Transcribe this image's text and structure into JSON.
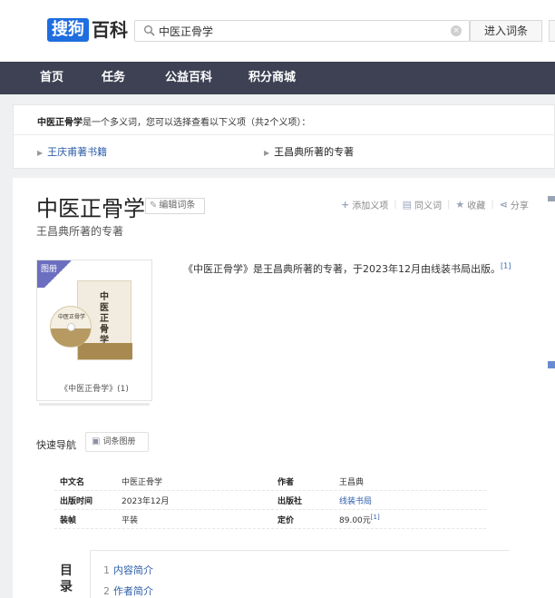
{
  "header": {
    "logo_badge": "搜狗",
    "logo_text": "百科",
    "search_value": "中医正骨学",
    "search_placeholder": "",
    "enter_button": "进入词条"
  },
  "nav": {
    "items": [
      "首页",
      "任务",
      "公益百科",
      "积分商城"
    ]
  },
  "disambiguation": {
    "term": "中医正骨学",
    "text": "是一个多义词，您可以选择查看以下义项（共2个义项）：",
    "options": [
      "王庆甫著书籍",
      "王昌典所著的专著"
    ]
  },
  "entry": {
    "title": "中医正骨学",
    "edit_label": "编辑词条",
    "subtitle": "王昌典所著的专著",
    "actions": [
      {
        "icon": "plus-icon",
        "glyph": "+",
        "label": "添加义项"
      },
      {
        "icon": "book-icon",
        "glyph": "▤",
        "label": "同义词"
      },
      {
        "icon": "star-icon",
        "glyph": "★",
        "label": "收藏"
      },
      {
        "icon": "share-icon",
        "glyph": "⋖",
        "label": "分享"
      }
    ],
    "album_tag": "图册",
    "album_caption": "《中医正骨学》(1)",
    "book_cover_title": "中医正骨学",
    "summary_text": "《中医正骨学》是王昌典所著的专著，于2023年12月由线装书局出版。",
    "summary_ref": "[1]"
  },
  "quick_nav": {
    "label": "快速导航",
    "button": "词条图册"
  },
  "info": {
    "rows": [
      {
        "k1": "中文名",
        "v1": "中医正骨学",
        "k2": "作者",
        "v2": "王昌典",
        "v2_link": false,
        "v2_ref": ""
      },
      {
        "k1": "出版时间",
        "v1": "2023年12月",
        "k2": "出版社",
        "v2": "线装书局",
        "v2_link": true,
        "v2_ref": ""
      },
      {
        "k1": "装帧",
        "v1": "平装",
        "k2": "定价",
        "v2": "89.00元",
        "v2_link": false,
        "v2_ref": "[1]"
      }
    ]
  },
  "toc": {
    "label": "目录",
    "items": [
      {
        "num": "1",
        "label": "内容简介"
      },
      {
        "num": "2",
        "label": "作者简介"
      }
    ]
  },
  "colors": {
    "nav_bg": "#3d4153",
    "logo_blue": "#1f6ee0",
    "link_blue": "#2d5ea8",
    "album_tag": "#6c6fbf"
  }
}
